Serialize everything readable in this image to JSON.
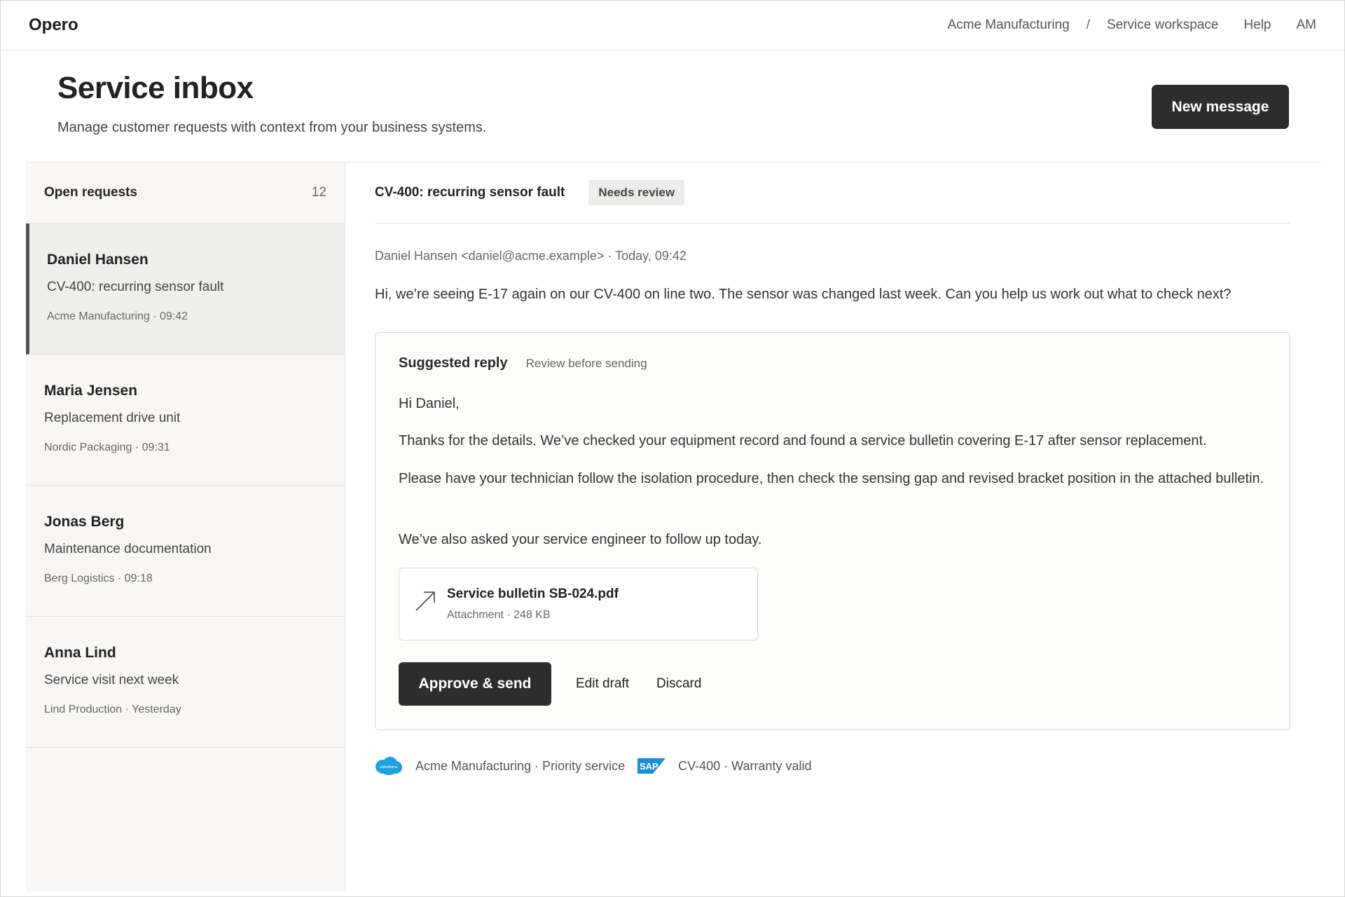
{
  "app": {
    "brand": "Opero",
    "nav": {
      "org": "Acme Manufacturing",
      "separator": "/",
      "workspace": "Service workspace",
      "help": "Help",
      "user_initials": "AM"
    }
  },
  "header": {
    "title": "Service inbox",
    "subtitle": "Manage customer requests with context from your business systems.",
    "new_message_label": "New message"
  },
  "requests": {
    "title": "Open requests",
    "count": "12",
    "items": [
      {
        "name": "Daniel Hansen",
        "subject": "CV-400: recurring sensor fault",
        "meta": "Acme Manufacturing · 09:42",
        "active": true
      },
      {
        "name": "Maria Jensen",
        "subject": "Replacement drive unit",
        "meta": "Nordic Packaging · 09:31",
        "active": false
      },
      {
        "name": "Jonas Berg",
        "subject": "Maintenance documentation",
        "meta": "Berg Logistics · 09:18",
        "active": false
      },
      {
        "name": "Anna Lind",
        "subject": "Service visit next week",
        "meta": "Lind Production · Yesterday",
        "active": false
      }
    ]
  },
  "message": {
    "subject": "CV-400: recurring sensor fault",
    "badge": "Needs review",
    "sender_line": "Daniel Hansen <daniel@acme.example> · Today, 09:42",
    "body": "Hi, we’re seeing E-17 again on our CV-400 on line two. The sensor was changed last week. Can you help us work out what to check next?"
  },
  "suggested_reply": {
    "title": "Suggested reply",
    "note": "Review before sending",
    "greeting": "Hi Daniel,",
    "paragraph_1": "Thanks for the details. We’ve checked your equipment record and found a service bulletin covering E-17 after sensor replacement.",
    "paragraph_2": "Please have your technician follow the isolation procedure, then check the sensing gap and revised bracket position in the attached bulletin.",
    "paragraph_3": "We’ve also asked your service engineer to follow up today.",
    "attachment": {
      "name": "Service bulletin SB-024.pdf",
      "meta": "Attachment · 248 KB"
    },
    "approve_label": "Approve & send",
    "edit_label": "Edit draft",
    "discard_label": "Discard"
  },
  "context": {
    "crm_logo_text": "salesforce",
    "crm_text": "Acme Manufacturing · Priority service",
    "erp_logo_text": "SAP",
    "erp_text": "CV-400 · Warranty valid"
  },
  "colors": {
    "primary_button": "#2d2d2d",
    "salesforce_blue": "#1aa3df",
    "sap_blue": "#1a8fd6"
  }
}
